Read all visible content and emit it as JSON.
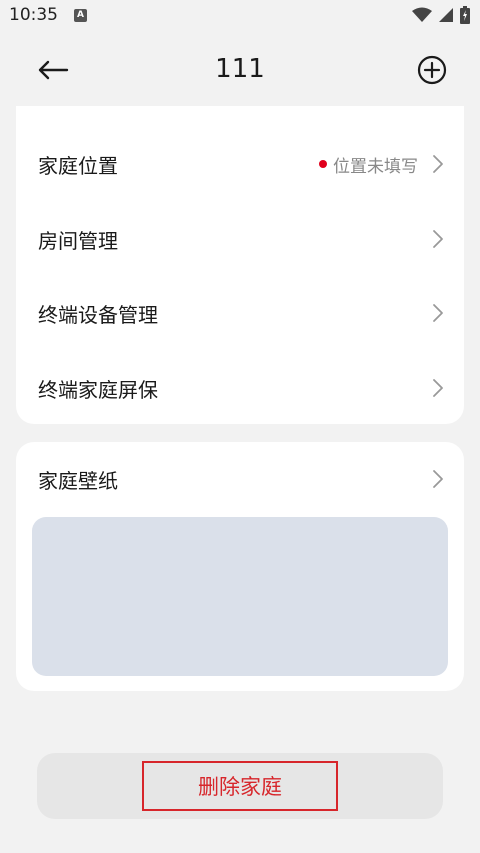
{
  "status_bar": {
    "time": "10:35",
    "badge": "A"
  },
  "header": {
    "title": "111"
  },
  "settings_card": {
    "items": [
      {
        "label": "家庭位置",
        "status": "位置未填写"
      },
      {
        "label": "房间管理"
      },
      {
        "label": "终端设备管理"
      },
      {
        "label": "终端家庭屏保"
      }
    ]
  },
  "wallpaper_card": {
    "label": "家庭壁纸"
  },
  "actions": {
    "delete_label": "删除家庭"
  },
  "colors": {
    "accent_red": "#d7262b",
    "status_dot": "#e0001c",
    "wallpaper_preview": "#dae0ea"
  },
  "icons": [
    "back-arrow-icon",
    "add-circle-icon",
    "chevron-right-icon",
    "wifi-icon",
    "signal-icon",
    "battery-icon"
  ]
}
